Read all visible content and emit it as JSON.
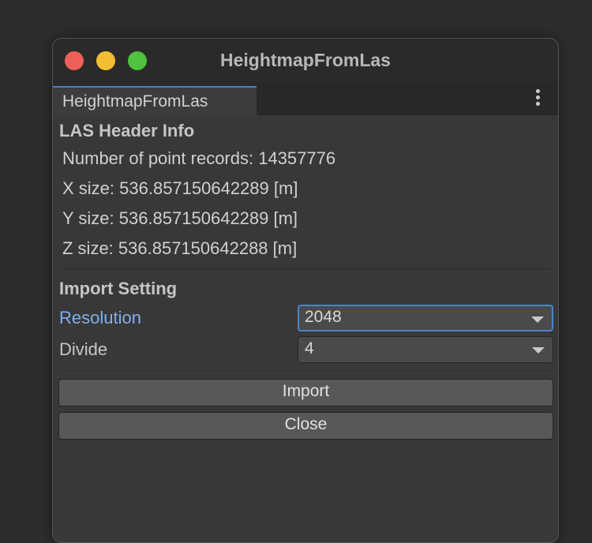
{
  "window": {
    "title": "HeightmapFromLas",
    "tab_label": "HeightmapFromLas"
  },
  "header_info": {
    "section_title": "LAS Header Info",
    "lines": [
      "Number of point records: 14357776",
      "X size: 536.857150642289 [m]",
      "Y size: 536.857150642289 [m]",
      "Z size: 536.857150642288 [m]"
    ]
  },
  "import_setting": {
    "section_title": "Import Setting",
    "resolution": {
      "label": "Resolution",
      "value": "2048"
    },
    "divide": {
      "label": "Divide",
      "value": "4"
    }
  },
  "buttons": {
    "import_label": "Import",
    "close_label": "Close"
  },
  "colors": {
    "accent": "#4a83cf",
    "active_label": "#7fb0ef",
    "traffic_close": "#ed5f57",
    "traffic_minimize": "#f5bd31",
    "traffic_maximize": "#4fc23f"
  }
}
